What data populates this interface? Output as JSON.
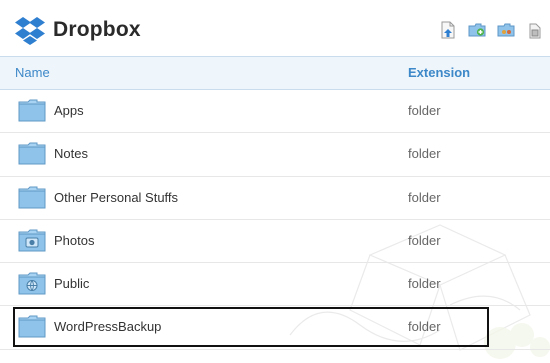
{
  "header": {
    "brand": "Dropbox",
    "logo_icon": "dropbox-logo-icon",
    "toolbar": [
      {
        "icon": "upload-icon"
      },
      {
        "icon": "new-folder-icon"
      },
      {
        "icon": "share-folder-icon"
      },
      {
        "icon": "deleted-files-icon"
      }
    ]
  },
  "table": {
    "col_name": "Name",
    "col_extension": "Extension"
  },
  "files": [
    {
      "name": "Apps",
      "extension": "folder",
      "icon": "folder-icon"
    },
    {
      "name": "Notes",
      "extension": "folder",
      "icon": "folder-icon"
    },
    {
      "name": "Other Personal Stuffs",
      "extension": "folder",
      "icon": "folder-icon"
    },
    {
      "name": "Photos",
      "extension": "folder",
      "icon": "photos-folder-icon"
    },
    {
      "name": "Public",
      "extension": "folder",
      "icon": "public-folder-icon"
    },
    {
      "name": "WordPressBackup",
      "extension": "folder",
      "icon": "folder-icon",
      "selected": true
    }
  ],
  "colors": {
    "accent": "#3d88c8",
    "header_bg": "#eef5fb",
    "folder": "#8fc3ea"
  }
}
